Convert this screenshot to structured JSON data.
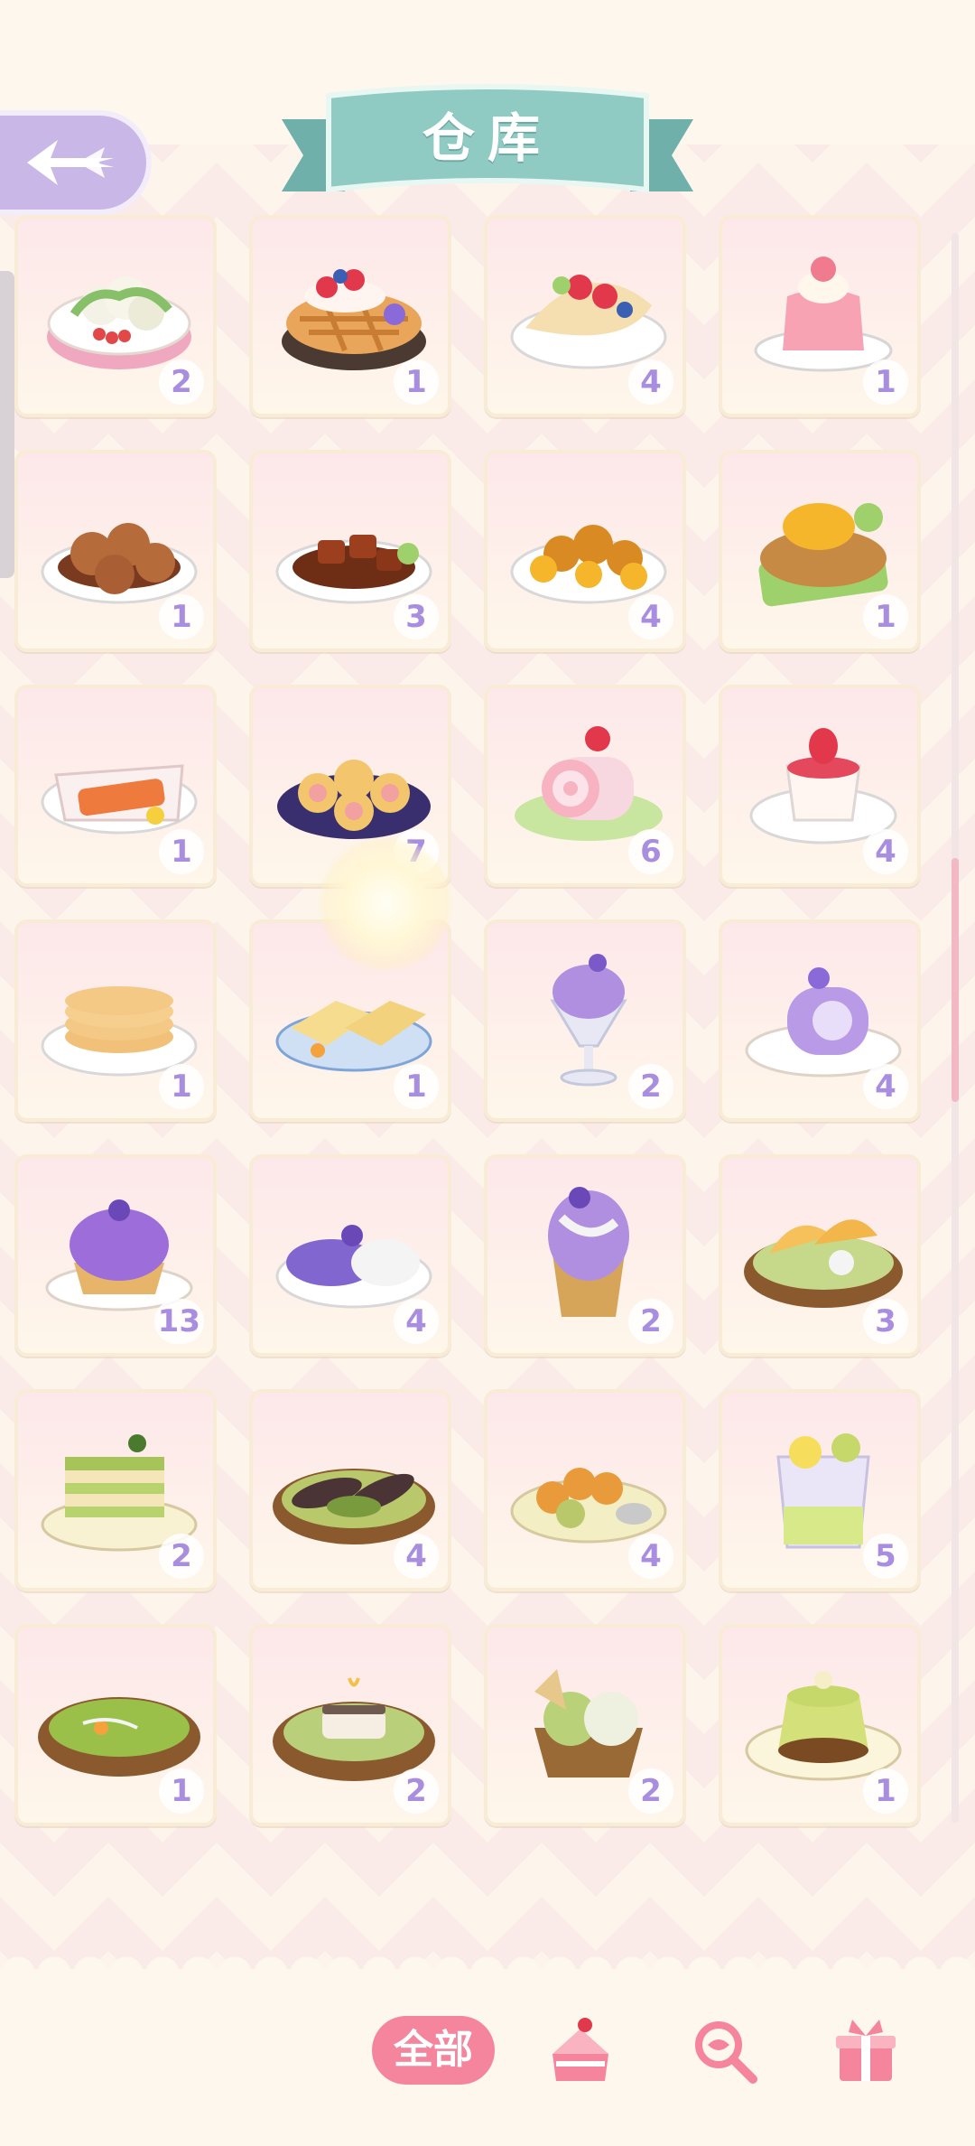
{
  "header": {
    "title": "仓库"
  },
  "colors": {
    "accent": "#f4859c",
    "count_text": "#a98ee0",
    "ribbon": "#7fc0b8",
    "back_button": "#c9b7e8"
  },
  "items": [
    {
      "name": "cauliflower-salad",
      "count": "2"
    },
    {
      "name": "berry-pie",
      "count": "1"
    },
    {
      "name": "fruit-crepe",
      "count": "4"
    },
    {
      "name": "strawberry-jelly",
      "count": "1"
    },
    {
      "name": "meatballs",
      "count": "1"
    },
    {
      "name": "braised-pork",
      "count": "3"
    },
    {
      "name": "orange-chicken",
      "count": "4"
    },
    {
      "name": "fish-platter",
      "count": "1"
    },
    {
      "name": "roasted-fish",
      "count": "1"
    },
    {
      "name": "swiss-roll-buns",
      "count": "7"
    },
    {
      "name": "strawberry-roll-cake",
      "count": "6"
    },
    {
      "name": "strawberry-pudding",
      "count": "4"
    },
    {
      "name": "pancakes",
      "count": "1"
    },
    {
      "name": "toast-sandwich",
      "count": "1"
    },
    {
      "name": "taro-sundae",
      "count": "2"
    },
    {
      "name": "taro-roll-cake",
      "count": "4"
    },
    {
      "name": "taro-tart",
      "count": "13"
    },
    {
      "name": "taro-rice",
      "count": "4"
    },
    {
      "name": "taro-crepe",
      "count": "2"
    },
    {
      "name": "taco-salad",
      "count": "3"
    },
    {
      "name": "matcha-mille-crepe",
      "count": "2"
    },
    {
      "name": "matcha-eggplant",
      "count": "4"
    },
    {
      "name": "fried-balls-sauce",
      "count": "4"
    },
    {
      "name": "lemon-soda",
      "count": "5"
    },
    {
      "name": "matcha-soup",
      "count": "1"
    },
    {
      "name": "fish-congee",
      "count": "2"
    },
    {
      "name": "matcha-ice-cream",
      "count": "2"
    },
    {
      "name": "matcha-pudding",
      "count": "1"
    }
  ],
  "tabs": {
    "all_label": "全部",
    "icons": [
      "cake-icon",
      "search-fish-icon",
      "gift-box-icon"
    ]
  }
}
